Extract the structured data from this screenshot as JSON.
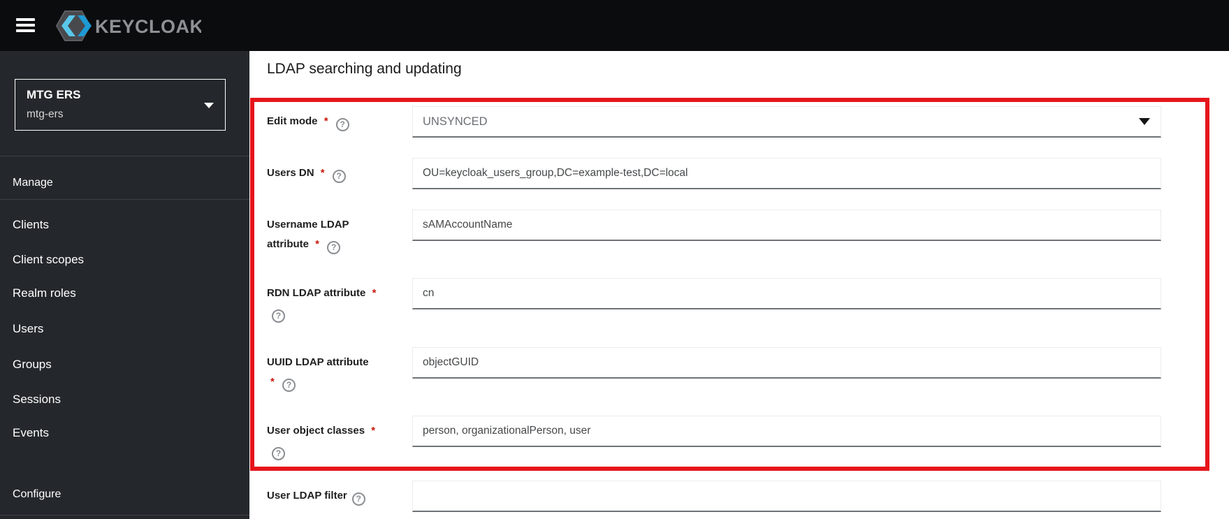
{
  "header": {
    "brand": "KEYCLOAK"
  },
  "icons": {
    "help_glyph": "?"
  },
  "sidebar": {
    "realm": {
      "name": "MTG ERS",
      "id": "mtg-ers"
    },
    "manage_label": "Manage",
    "configure_label": "Configure",
    "items": [
      {
        "label": "Clients"
      },
      {
        "label": "Client scopes"
      },
      {
        "label": "Realm roles"
      },
      {
        "label": "Users"
      },
      {
        "label": "Groups"
      },
      {
        "label": "Sessions"
      },
      {
        "label": "Events"
      }
    ]
  },
  "main": {
    "heading": "LDAP searching and updating",
    "annotation_color": "#e5151b",
    "form": {
      "groups": [
        {
          "label": "Edit mode",
          "required_mark": "*",
          "value": "UNSYNCED",
          "control": "select"
        },
        {
          "label": "Users DN",
          "required_mark": "*",
          "value": "OU=keycloak_users_group,DC=example-test,DC=local",
          "control": "text"
        },
        {
          "label": "Username LDAP attribute",
          "required_mark": "*",
          "value": "sAMAccountName",
          "control": "text"
        },
        {
          "label": "RDN LDAP attribute",
          "required_mark": "*",
          "value": "cn",
          "control": "text"
        },
        {
          "label": "UUID LDAP attribute",
          "required_mark": "*",
          "value": "objectGUID",
          "control": "text"
        },
        {
          "label": "User object classes",
          "required_mark": "*",
          "value": "person, organizationalPerson, user",
          "control": "text"
        },
        {
          "label": "User LDAP filter",
          "required_mark": "",
          "value": "",
          "control": "text"
        }
      ]
    }
  }
}
